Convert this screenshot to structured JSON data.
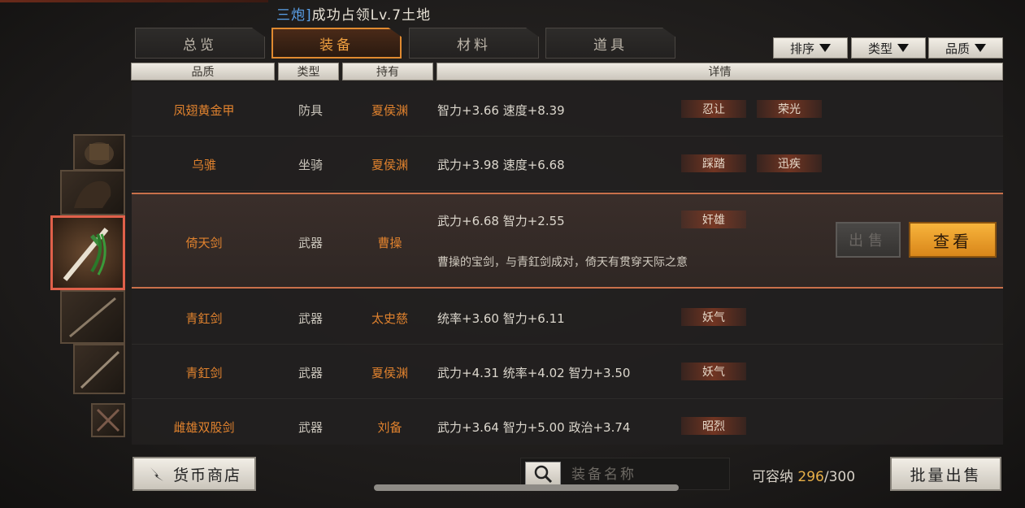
{
  "notice": {
    "prefix": "三炮]",
    "text": "成功占领Lv.7土地"
  },
  "tabs": [
    {
      "label": "总览",
      "active": false
    },
    {
      "label": "装备",
      "active": true
    },
    {
      "label": "材料",
      "active": false
    },
    {
      "label": "道具",
      "active": false
    }
  ],
  "filters": [
    "排序",
    "类型",
    "品质"
  ],
  "columns": {
    "quality": "品质",
    "type": "类型",
    "owner": "持有",
    "details": "详情"
  },
  "rows": [
    {
      "name": "凤翅黄金甲",
      "type": "防具",
      "owner": "夏侯渊",
      "stats": "智力+3.66  速度+8.39",
      "tags": [
        "忍让",
        "荣光"
      ]
    },
    {
      "name": "乌骓",
      "type": "坐骑",
      "owner": "夏侯渊",
      "stats": "武力+3.98  速度+6.68",
      "tags": [
        "踩踏",
        "迅疾"
      ]
    },
    {
      "name": "倚天剑",
      "type": "武器",
      "owner": "曹操",
      "stats": "武力+6.68  智力+2.55",
      "tags": [
        "奸雄"
      ],
      "description": "曹操的宝剑，与青釭剑成对，倚天有贯穿天际之意",
      "selected": true
    },
    {
      "name": "青釭剑",
      "type": "武器",
      "owner": "太史慈",
      "stats": "统率+3.60  智力+6.11",
      "tags": [
        "妖气"
      ]
    },
    {
      "name": "青釭剑",
      "type": "武器",
      "owner": "夏侯渊",
      "stats": "武力+4.31  统率+4.02  智力+3.50",
      "tags": [
        "妖气"
      ]
    },
    {
      "name": "雌雄双股剑",
      "type": "武器",
      "owner": "刘备",
      "stats": "武力+3.64  智力+5.00  政治+3.74",
      "tags": [
        "昭烈"
      ]
    }
  ],
  "actions": {
    "sell": "出售",
    "view": "查看"
  },
  "bottom": {
    "shop": "货币商店",
    "search_placeholder": "装备名称",
    "capacity_label": "可容纳",
    "capacity_used": "296",
    "capacity_total": "/300",
    "batch_sell": "批量出售"
  },
  "colors": {
    "accent": "#e0822e",
    "highlight": "#f7b43c",
    "selected_border": "#c9704a"
  }
}
